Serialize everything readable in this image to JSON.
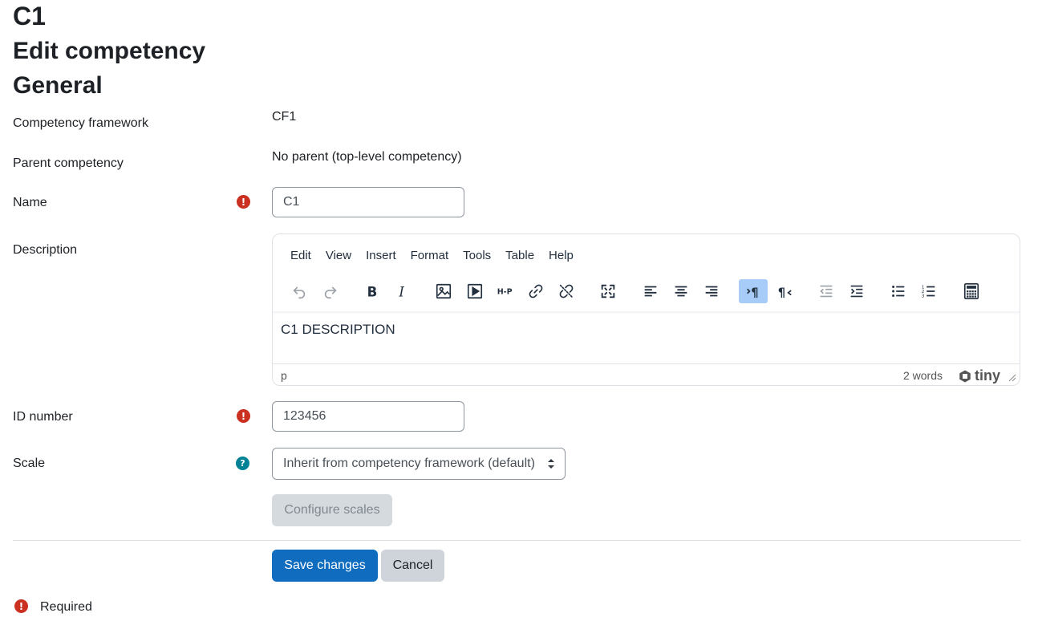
{
  "headings": {
    "course": "C1",
    "page": "Edit competency",
    "section": "General"
  },
  "fields": {
    "framework": {
      "label": "Competency framework",
      "value": "CF1"
    },
    "parent": {
      "label": "Parent competency",
      "value": "No parent (top-level competency)"
    },
    "name": {
      "label": "Name",
      "value": "C1"
    },
    "description": {
      "label": "Description"
    },
    "idnumber": {
      "label": "ID number",
      "value": "123456"
    },
    "scale": {
      "label": "Scale",
      "value": "Inherit from competency framework (default)"
    }
  },
  "editor": {
    "menus": [
      "Edit",
      "View",
      "Insert",
      "Format",
      "Tools",
      "Table",
      "Help"
    ],
    "content": "C1 DESCRIPTION",
    "status_path": "p",
    "word_count": "2 words",
    "brand": "tiny"
  },
  "toolbar_icons": [
    "undo-icon",
    "redo-icon",
    "bold-icon",
    "italic-icon",
    "image-icon",
    "media-icon",
    "h5p-icon",
    "link-icon",
    "unlink-icon",
    "fullscreen-icon",
    "align-left-icon",
    "align-center-icon",
    "align-right-icon",
    "ltr-icon",
    "rtl-icon",
    "outdent-icon",
    "indent-icon",
    "bullet-list-icon",
    "numbered-list-icon",
    "calculator-icon"
  ],
  "buttons": {
    "configure_scales": "Configure scales",
    "save": "Save changes",
    "cancel": "Cancel"
  },
  "footer": {
    "required_label": "Required"
  },
  "colors": {
    "required": "#ca3120",
    "help": "#008196",
    "primary": "#0f6cbf",
    "secondary": "#ced4da",
    "active_toolbar": "#a6ccf7"
  }
}
